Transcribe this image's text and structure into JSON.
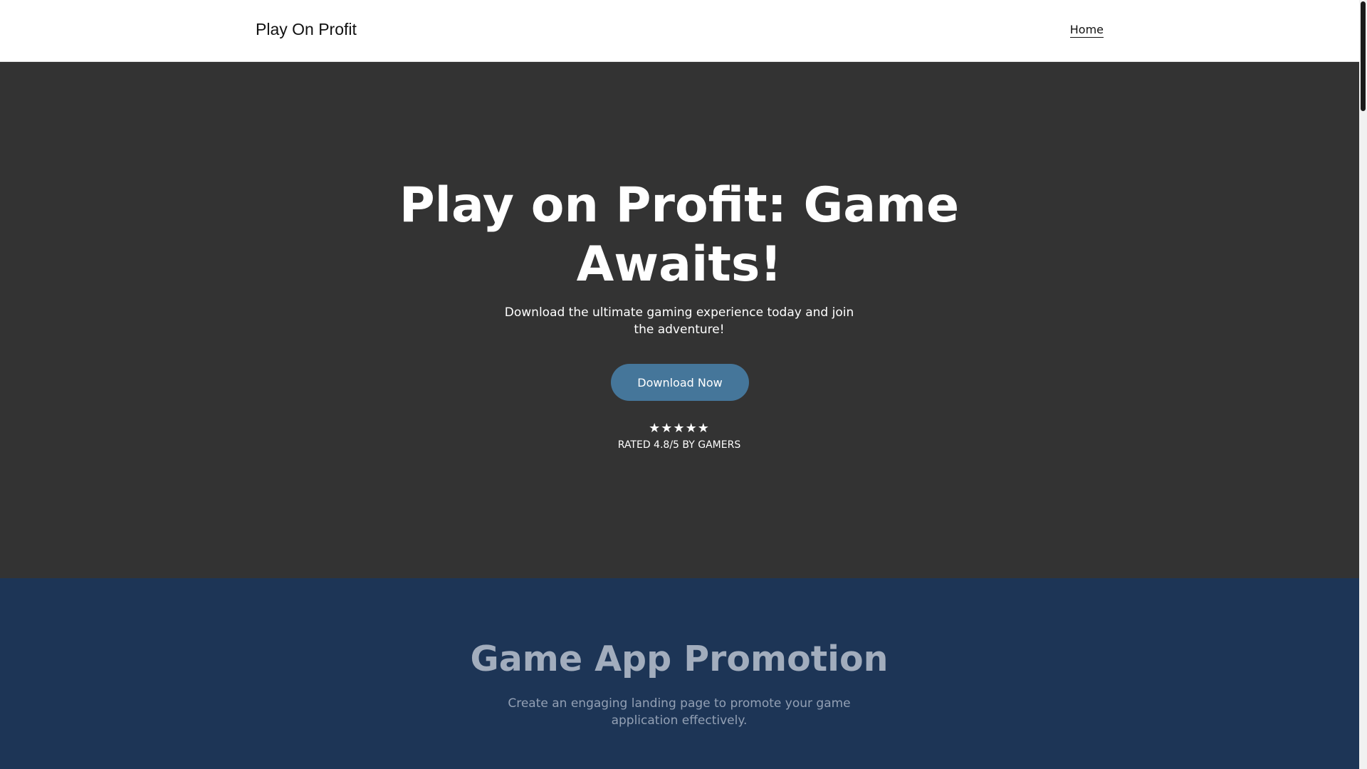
{
  "header": {
    "brand": "Play On Profit",
    "nav": [
      {
        "label": "Home"
      }
    ]
  },
  "hero": {
    "title": "Play on Profit: Game Awaits!",
    "subtitle": "Download the ultimate gaming experience today and join the adventure!",
    "cta_label": "Download Now",
    "rating": {
      "stars": "★★★★★",
      "text": "RATED 4.8/5 BY GAMERS",
      "value": 4.8,
      "max": 5
    }
  },
  "promo": {
    "title": "Game App Promotion",
    "subtitle": "Create an engaging landing page to promote your game application effectively."
  },
  "colors": {
    "hero_bg": "#333333",
    "promo_bg": "#1d3556",
    "cta_bg": "#45769a",
    "header_bg": "#ffffff"
  }
}
